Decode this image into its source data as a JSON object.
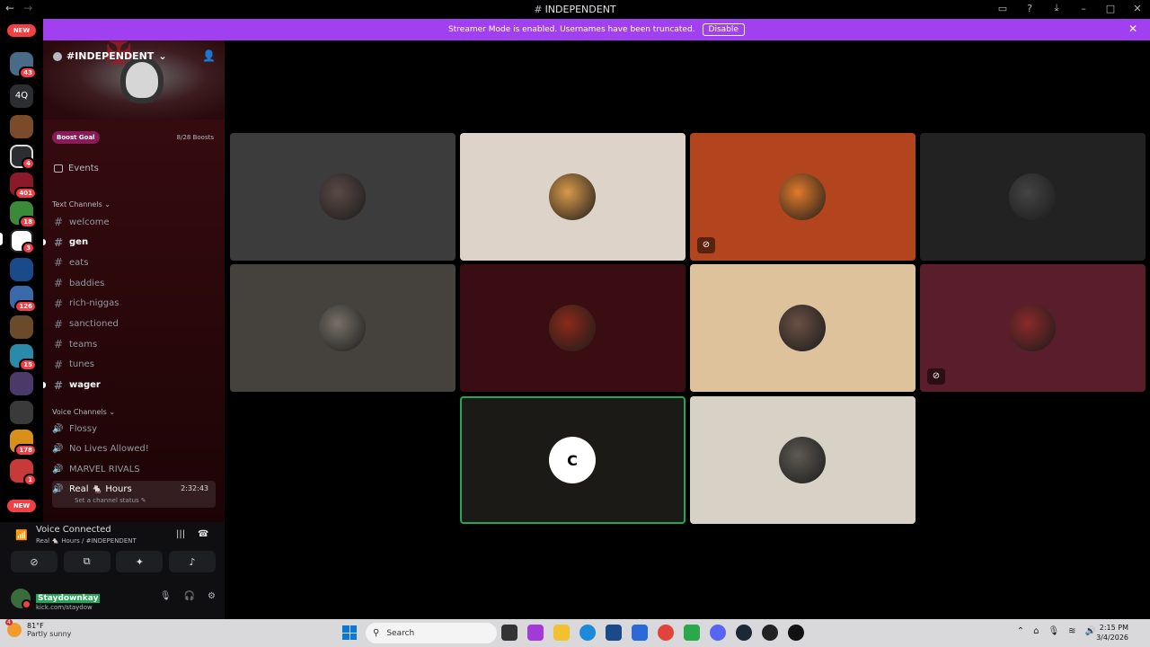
{
  "window": {
    "title_hash": "#",
    "title": "INDEPENDENT",
    "back": "←",
    "forward": "→"
  },
  "streamer_banner": {
    "message": "Streamer Mode is enabled. Usernames have been truncated.",
    "disable_label": "Disable",
    "close": "✕"
  },
  "server_rail": {
    "new_label_top": "NEW",
    "new_label_bottom": "NEW",
    "text_server": "4Q",
    "badges": [
      "43",
      "4",
      "401",
      "18",
      "3",
      "126",
      "15",
      "178",
      "1"
    ]
  },
  "server": {
    "name": "#INDEPENDENT",
    "boost_goal": "Boost Goal",
    "boost_count": "8/28 Boosts",
    "events": "Events"
  },
  "text_channels": {
    "category": "Text Channels",
    "items": [
      {
        "name": "welcome",
        "unread": false
      },
      {
        "name": "gen",
        "unread": true
      },
      {
        "name": "eats",
        "unread": false
      },
      {
        "name": "baddies",
        "unread": false
      },
      {
        "name": "rich-niggas",
        "unread": false
      },
      {
        "name": "sanctioned",
        "unread": false
      },
      {
        "name": "teams",
        "unread": false
      },
      {
        "name": "tunes",
        "unread": false
      },
      {
        "name": "wager",
        "unread": true
      }
    ]
  },
  "voice_channels": {
    "category": "Voice Channels",
    "items": [
      {
        "name": "Flossy"
      },
      {
        "name": "No Lives Allowed!"
      },
      {
        "name": "MARVEL RIVALS"
      }
    ],
    "active": {
      "name": "Real 🐁 Hours",
      "timer": "2:32:43",
      "status": "Set a channel status ✎"
    }
  },
  "voice_panel": {
    "title": "Voice Connected",
    "subtitle": "Real 🐁 Hours / #INDEPENDENT"
  },
  "user": {
    "name": "Staydownkay",
    "status": "kick.com/staydow"
  },
  "tiles": [
    {
      "bg": "#3c3c3c",
      "avatar": "#5a4a45",
      "video_off": false
    },
    {
      "bg": "#ddd3c9",
      "avatar": "#d89a4a",
      "video_off": false
    },
    {
      "bg": "#b2451e",
      "avatar": "#e07a2a",
      "video_off": true
    },
    {
      "bg": "#222222",
      "avatar": "#444444",
      "video_off": false
    },
    {
      "bg": "#45423e",
      "avatar": "#777066",
      "video_off": false
    },
    {
      "bg": "#3a0d12",
      "avatar": "#8a2a1a",
      "video_off": false
    },
    {
      "bg": "#dec29b",
      "avatar": "#6a5044",
      "video_off": false
    },
    {
      "bg": "#5a1d2b",
      "avatar": "#8b2a2a",
      "video_off": true
    },
    {
      "bg": "#1b1a16",
      "avatar": "#ffffff",
      "video_off": false,
      "speaking": true,
      "initial": "C"
    },
    {
      "bg": "#d8d2c6",
      "avatar": "#5e5a52",
      "video_off": false
    }
  ],
  "taskbar": {
    "temp": "81°F",
    "weather": "Partly sunny",
    "weather_badge": "4",
    "search": "Search",
    "time": "2:15 PM",
    "date": "3/4/2026"
  }
}
